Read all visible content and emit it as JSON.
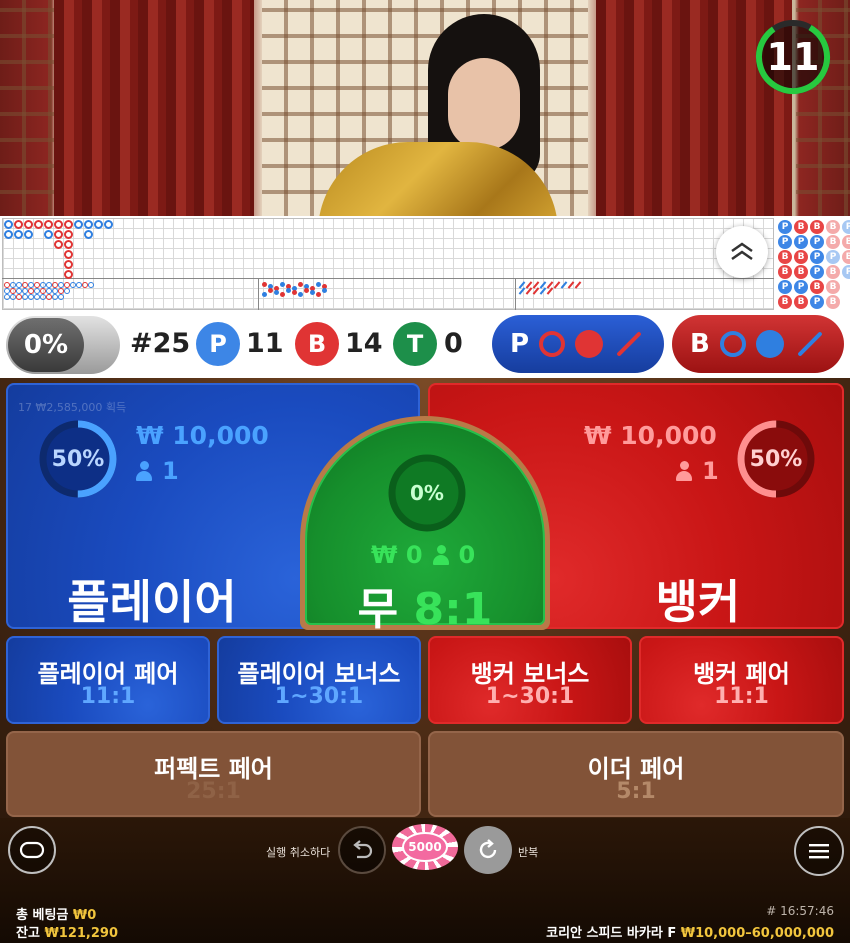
{
  "timer": {
    "value": "11"
  },
  "stats": {
    "percent_toggle": "0%",
    "round": "#25",
    "player_letter": "P",
    "player_count": "11",
    "banker_letter": "B",
    "banker_count": "14",
    "tie_letter": "T",
    "tie_count": "0",
    "player_predict_letter": "P",
    "banker_predict_letter": "B"
  },
  "beadplate": [
    "P",
    "P",
    "B",
    "B",
    "P",
    "B",
    "B",
    "P",
    "B",
    "B",
    "P",
    "B",
    "B",
    "P",
    "P",
    "P",
    "B",
    "P",
    "B",
    "B",
    "P",
    "B",
    "B",
    "B",
    "P",
    "B",
    "B",
    "P"
  ],
  "player_zone": {
    "pct": "50%",
    "amount": "₩ 10,000",
    "players": "1",
    "label": "플레이어",
    "faint_text": "17 ₩2,585,000 획득"
  },
  "banker_zone": {
    "pct": "50%",
    "amount": "₩ 10,000",
    "players": "1",
    "label": "뱅커"
  },
  "tie_zone": {
    "pct": "0%",
    "amount": "₩ 0",
    "players": "0",
    "label": "무",
    "odds": "8:1"
  },
  "side_bets": [
    {
      "label": "플레이어 페어",
      "odds": "11:1"
    },
    {
      "label": "플레이어 보너스",
      "odds": "1~30:1"
    },
    {
      "label": "뱅커 보너스",
      "odds": "1~30:1"
    },
    {
      "label": "뱅커 페어",
      "odds": "11:1"
    }
  ],
  "perfect_pair": {
    "label": "퍼펙트 페어",
    "odds": "25:1"
  },
  "either_pair": {
    "label": "이더 페어",
    "odds": "5:1"
  },
  "controls": {
    "undo_label": "실행 취소하다",
    "chip_value": "5000",
    "repeat_label": "반복"
  },
  "footer": {
    "total_bet_label": "총 베팅금",
    "total_bet_value": "₩0",
    "balance_label": "잔고",
    "balance_value": "₩121,290",
    "time": "# 16:57:46",
    "table_name": "코리안 스피드 바카라 F",
    "limits": "₩10,000–60,000,000"
  },
  "colors": {
    "player_blue": "#1a4bbf",
    "banker_red": "#c91616",
    "tie_green": "#168f2c",
    "gold": "#f2c53d"
  },
  "icons": [
    "chat-icon",
    "undo-icon",
    "repeat-icon",
    "menu-icon",
    "chevron-up-icon",
    "person-icon"
  ]
}
